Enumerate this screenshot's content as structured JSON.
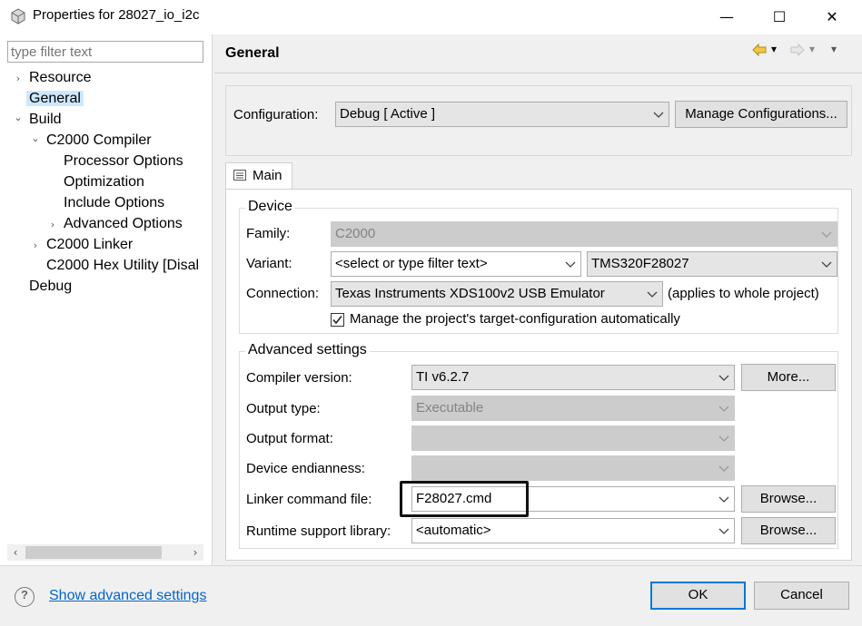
{
  "window": {
    "title": "Properties for 28027_io_i2c",
    "minimize_glyph": "—",
    "maximize_glyph": "☐",
    "close_glyph": "✕"
  },
  "sidebar": {
    "filter_placeholder": "type filter text",
    "items": [
      {
        "label": "Resource",
        "arrow": "›"
      },
      {
        "label": "General",
        "selected": true
      },
      {
        "label": "Build",
        "arrow": "⌄"
      },
      {
        "label": "C2000 Compiler",
        "arrow": "⌄"
      },
      {
        "label": "Processor Options"
      },
      {
        "label": "Optimization"
      },
      {
        "label": "Include Options"
      },
      {
        "label": "Advanced Options",
        "arrow": "›"
      },
      {
        "label": "C2000 Linker",
        "arrow": "›"
      },
      {
        "label": "C2000 Hex Utility  [Disal"
      },
      {
        "label": "Debug"
      }
    ],
    "scroll_left": "‹",
    "scroll_right": "›"
  },
  "header": {
    "title": "General",
    "back_icon": "back-arrow-icon",
    "forward_icon": "forward-arrow-icon",
    "dropdown_glyph": "▾"
  },
  "configuration": {
    "label": "Configuration:",
    "value": "Debug  [ Active ]",
    "manage_button": "Manage Configurations..."
  },
  "tab": {
    "label": "Main"
  },
  "device": {
    "group_title": "Device",
    "family_label": "Family:",
    "family_value": "C2000",
    "variant_label": "Variant:",
    "variant_filter": "<select or type filter text>",
    "variant_value": "TMS320F28027",
    "connection_label": "Connection:",
    "connection_value": "Texas Instruments XDS100v2 USB Emulator",
    "connection_note": "(applies to whole project)",
    "manage_checkbox_label": "Manage the project's target-configuration automatically",
    "manage_checked": true
  },
  "advanced": {
    "group_title": "Advanced settings",
    "compiler_version_label": "Compiler version:",
    "compiler_version_value": "TI v6.2.7",
    "more_button": "More...",
    "output_type_label": "Output type:",
    "output_type_value": "Executable",
    "output_format_label": "Output format:",
    "output_format_value": "",
    "device_endianness_label": "Device endianness:",
    "device_endianness_value": "",
    "linker_cmd_label": "Linker command file:",
    "linker_cmd_value": "F28027.cmd",
    "browse_button": "Browse...",
    "runtime_lib_label": "Runtime support library:",
    "runtime_lib_value": "<automatic>",
    "browse_button_2": "Browse..."
  },
  "footer": {
    "help_glyph": "?",
    "advanced_link": "Show advanced settings",
    "ok_button": "OK",
    "cancel_button": "Cancel"
  },
  "colors": {
    "selection": "#cce8ff",
    "link": "#0066cc",
    "ok_border": "#0078d7",
    "nav_arrow": "#d4a017"
  }
}
